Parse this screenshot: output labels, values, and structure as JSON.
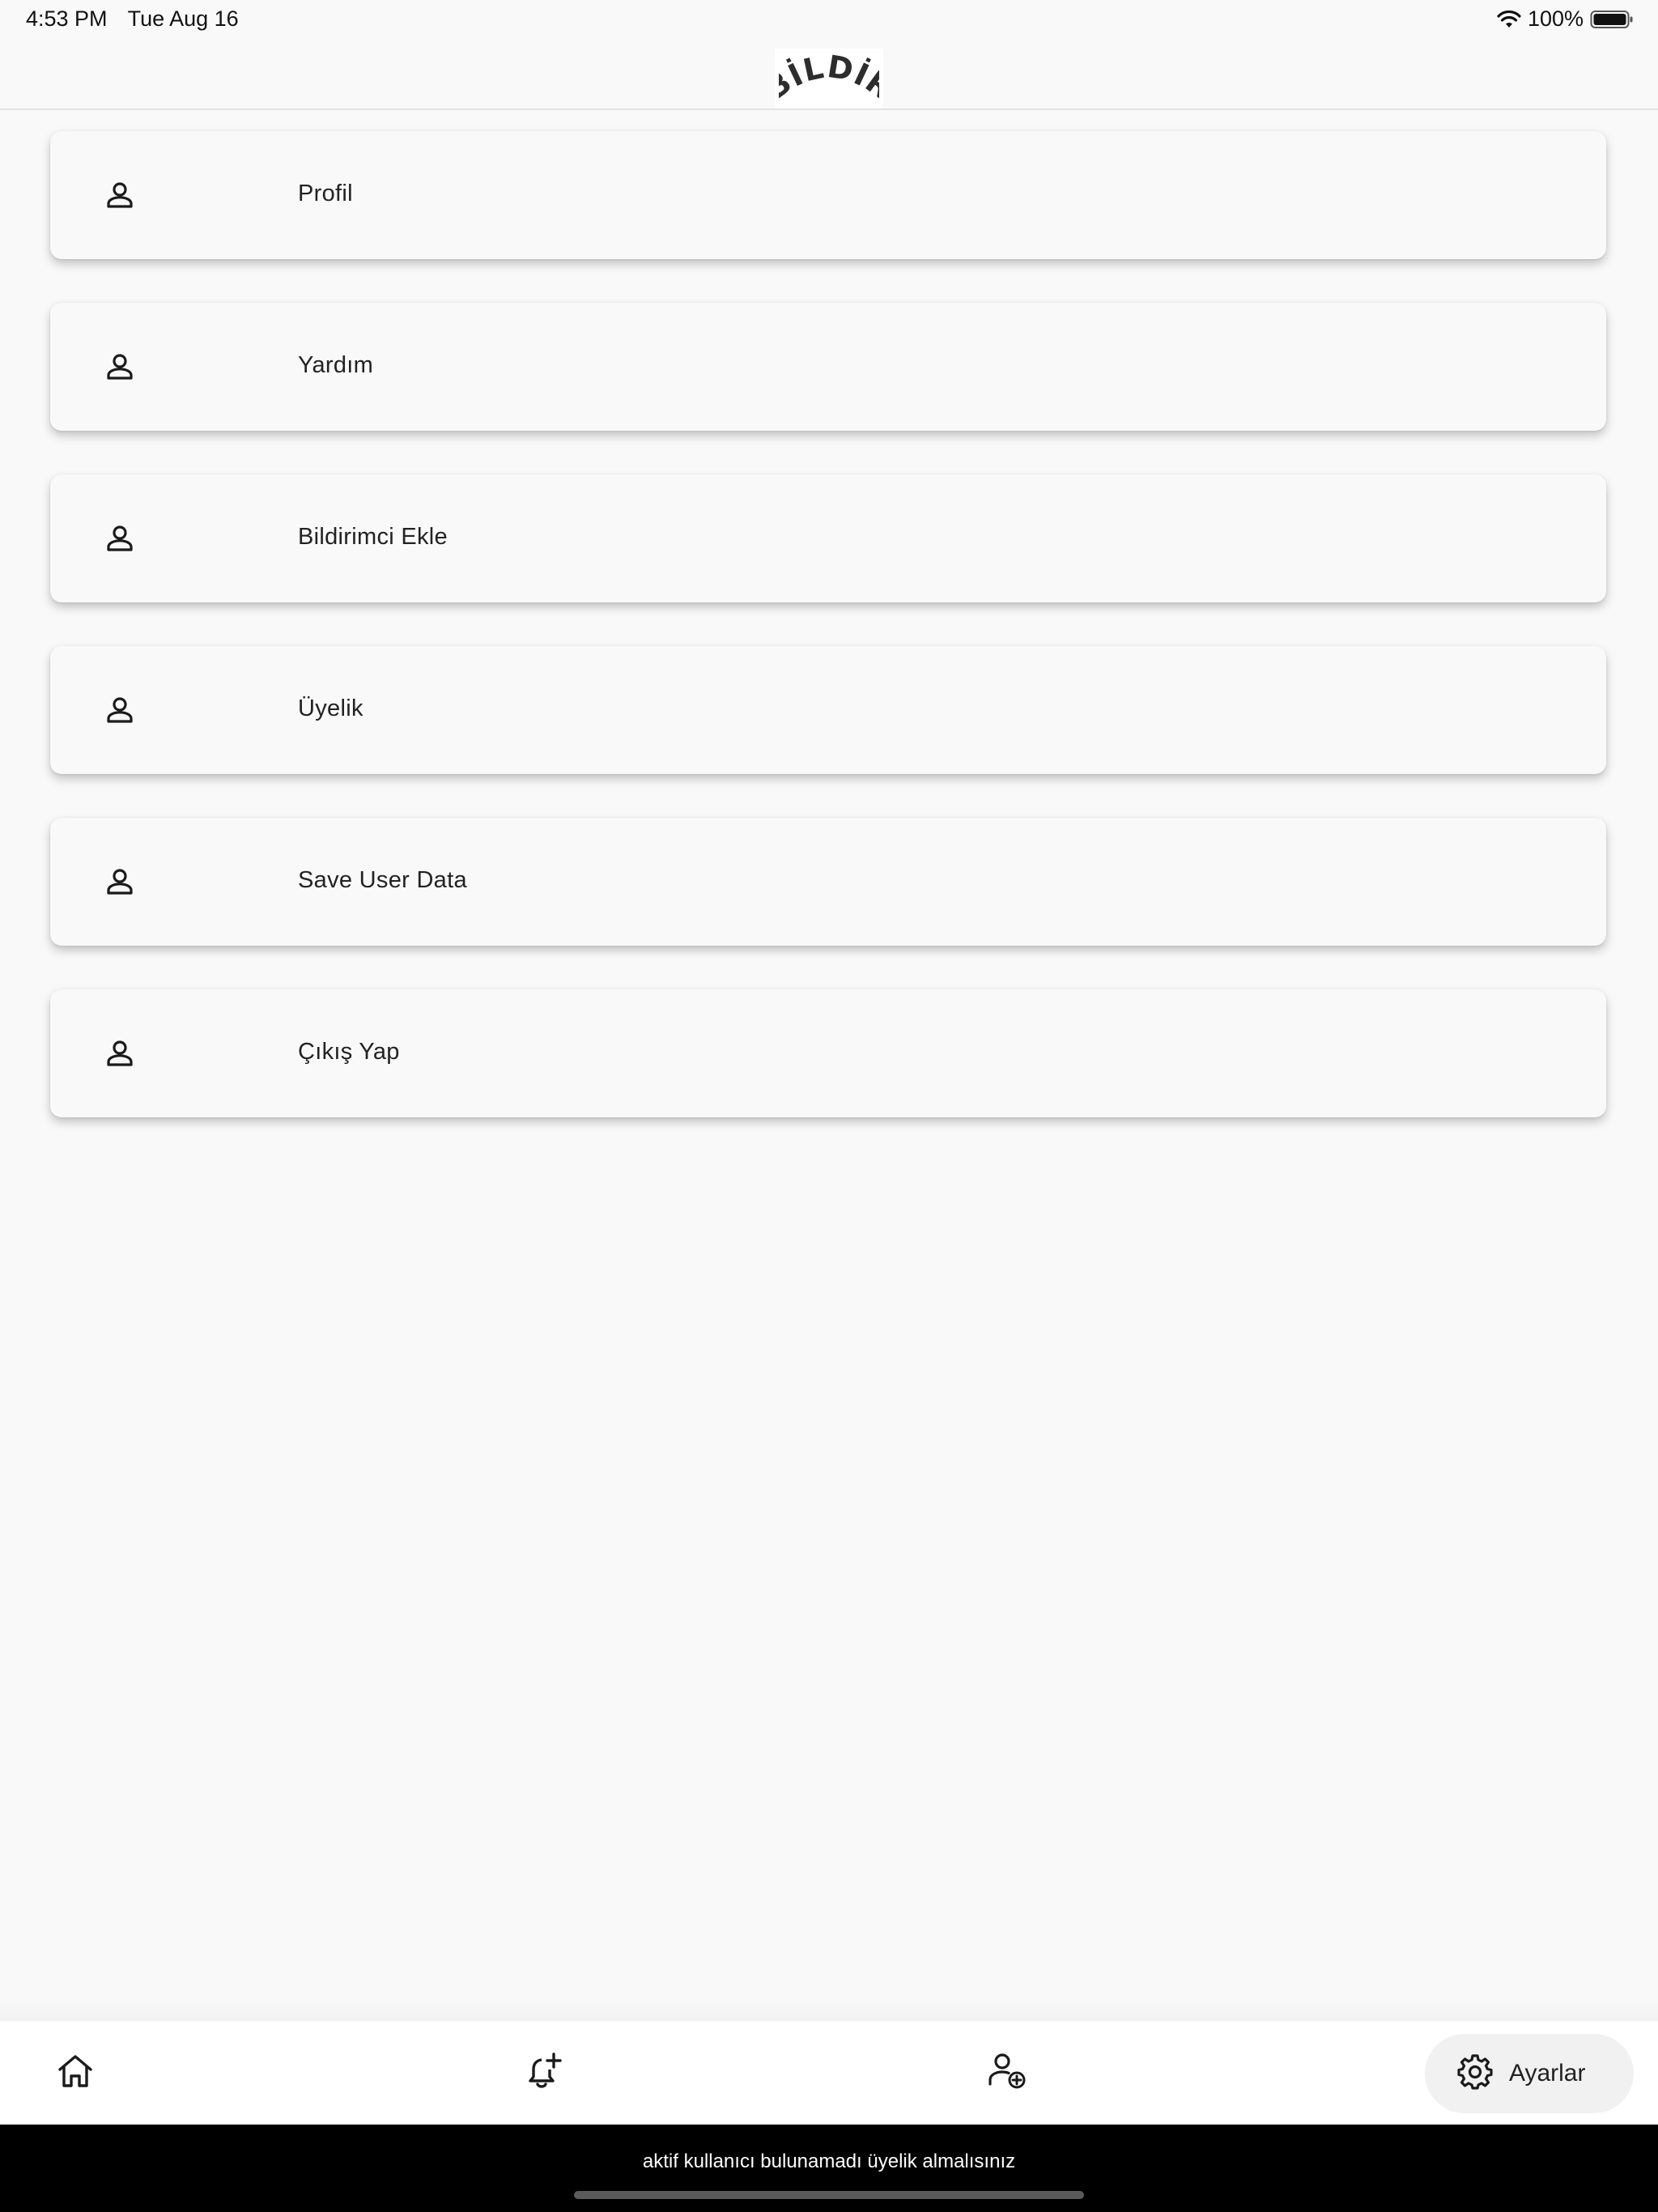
{
  "status_bar": {
    "time": "4:53 PM",
    "date": "Tue Aug 16",
    "battery": "100%"
  },
  "header": {
    "logo_text": "BİLDİR"
  },
  "menu": {
    "items": [
      {
        "label": "Profil",
        "icon": "person-icon"
      },
      {
        "label": "Yardım",
        "icon": "person-icon"
      },
      {
        "label": "Bildirimci Ekle",
        "icon": "person-icon"
      },
      {
        "label": "Üyelik",
        "icon": "person-icon"
      },
      {
        "label": "Save User Data",
        "icon": "person-icon"
      },
      {
        "label": "Çıkış Yap",
        "icon": "person-icon"
      }
    ]
  },
  "bottom_nav": {
    "items": [
      {
        "name": "home",
        "icon": "home-icon"
      },
      {
        "name": "add-notification",
        "icon": "bell-plus-icon"
      },
      {
        "name": "add-person",
        "icon": "person-add-icon"
      },
      {
        "name": "settings",
        "icon": "gear-icon",
        "label": "Ayarlar",
        "active": true
      }
    ]
  },
  "snackbar": {
    "message": "aktif kullanıcı bulunamadı üyelik almalısınız"
  },
  "colors": {
    "background": "#f9f9f9",
    "nav_active_pill": "#f1f1f1",
    "snackbar": "#000000"
  }
}
